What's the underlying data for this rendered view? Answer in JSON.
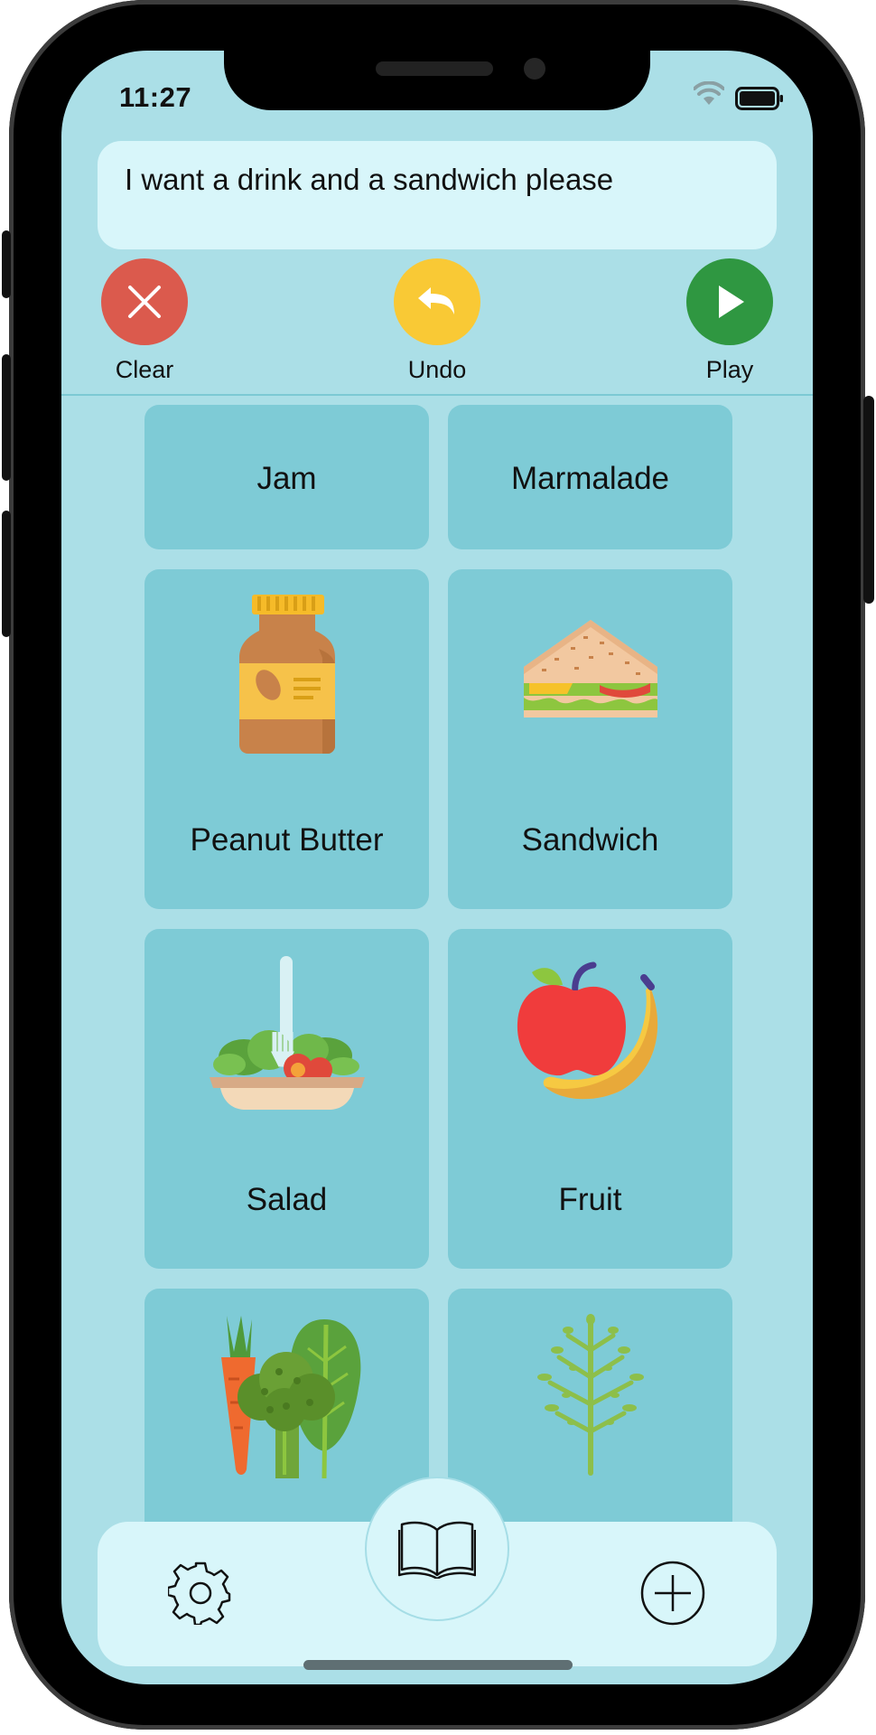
{
  "status_bar": {
    "time": "11:27"
  },
  "sentence": {
    "text": "I want a drink and a sandwich please"
  },
  "actions": {
    "clear_label": "Clear",
    "undo_label": "Undo",
    "play_label": "Play",
    "colors": {
      "clear": "#db5a4d",
      "undo": "#f9c935",
      "play": "#2f9741"
    }
  },
  "tiles": [
    {
      "label": "Jam",
      "icon": "none"
    },
    {
      "label": "Marmalade",
      "icon": "none"
    },
    {
      "label": "Peanut Butter",
      "icon": "peanut-butter-jar-icon"
    },
    {
      "label": "Sandwich",
      "icon": "sandwich-icon"
    },
    {
      "label": "Salad",
      "icon": "salad-icon"
    },
    {
      "label": "Fruit",
      "icon": "fruit-icon"
    },
    {
      "label": "",
      "icon": "vegetables-icon"
    },
    {
      "label": "",
      "icon": "herb-icon"
    }
  ],
  "bottom_nav": {
    "left_icon": "gear-icon",
    "center_icon": "book-icon",
    "right_icon": "plus-circle-icon"
  },
  "theme": {
    "background": "#abdfe7",
    "tile": "#7ecbd6",
    "panel": "#d8f6fa"
  }
}
